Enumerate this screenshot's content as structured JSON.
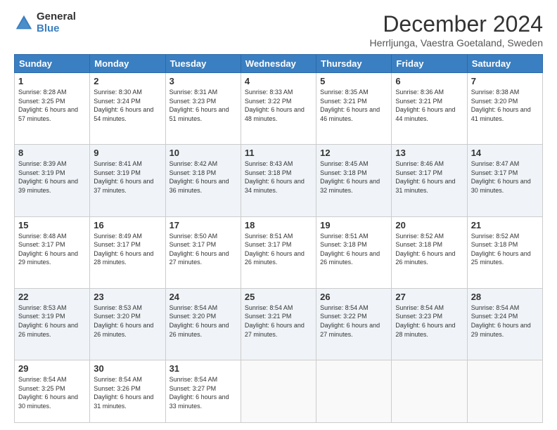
{
  "logo": {
    "general": "General",
    "blue": "Blue"
  },
  "header": {
    "month": "December 2024",
    "location": "Herrljunga, Vaestra Goetaland, Sweden"
  },
  "days_of_week": [
    "Sunday",
    "Monday",
    "Tuesday",
    "Wednesday",
    "Thursday",
    "Friday",
    "Saturday"
  ],
  "weeks": [
    [
      {
        "day": "1",
        "sunrise": "8:28 AM",
        "sunset": "3:25 PM",
        "daylight": "6 hours and 57 minutes."
      },
      {
        "day": "2",
        "sunrise": "8:30 AM",
        "sunset": "3:24 PM",
        "daylight": "6 hours and 54 minutes."
      },
      {
        "day": "3",
        "sunrise": "8:31 AM",
        "sunset": "3:23 PM",
        "daylight": "6 hours and 51 minutes."
      },
      {
        "day": "4",
        "sunrise": "8:33 AM",
        "sunset": "3:22 PM",
        "daylight": "6 hours and 48 minutes."
      },
      {
        "day": "5",
        "sunrise": "8:35 AM",
        "sunset": "3:21 PM",
        "daylight": "6 hours and 46 minutes."
      },
      {
        "day": "6",
        "sunrise": "8:36 AM",
        "sunset": "3:21 PM",
        "daylight": "6 hours and 44 minutes."
      },
      {
        "day": "7",
        "sunrise": "8:38 AM",
        "sunset": "3:20 PM",
        "daylight": "6 hours and 41 minutes."
      }
    ],
    [
      {
        "day": "8",
        "sunrise": "8:39 AM",
        "sunset": "3:19 PM",
        "daylight": "6 hours and 39 minutes."
      },
      {
        "day": "9",
        "sunrise": "8:41 AM",
        "sunset": "3:19 PM",
        "daylight": "6 hours and 37 minutes."
      },
      {
        "day": "10",
        "sunrise": "8:42 AM",
        "sunset": "3:18 PM",
        "daylight": "6 hours and 36 minutes."
      },
      {
        "day": "11",
        "sunrise": "8:43 AM",
        "sunset": "3:18 PM",
        "daylight": "6 hours and 34 minutes."
      },
      {
        "day": "12",
        "sunrise": "8:45 AM",
        "sunset": "3:18 PM",
        "daylight": "6 hours and 32 minutes."
      },
      {
        "day": "13",
        "sunrise": "8:46 AM",
        "sunset": "3:17 PM",
        "daylight": "6 hours and 31 minutes."
      },
      {
        "day": "14",
        "sunrise": "8:47 AM",
        "sunset": "3:17 PM",
        "daylight": "6 hours and 30 minutes."
      }
    ],
    [
      {
        "day": "15",
        "sunrise": "8:48 AM",
        "sunset": "3:17 PM",
        "daylight": "6 hours and 29 minutes."
      },
      {
        "day": "16",
        "sunrise": "8:49 AM",
        "sunset": "3:17 PM",
        "daylight": "6 hours and 28 minutes."
      },
      {
        "day": "17",
        "sunrise": "8:50 AM",
        "sunset": "3:17 PM",
        "daylight": "6 hours and 27 minutes."
      },
      {
        "day": "18",
        "sunrise": "8:51 AM",
        "sunset": "3:17 PM",
        "daylight": "6 hours and 26 minutes."
      },
      {
        "day": "19",
        "sunrise": "8:51 AM",
        "sunset": "3:18 PM",
        "daylight": "6 hours and 26 minutes."
      },
      {
        "day": "20",
        "sunrise": "8:52 AM",
        "sunset": "3:18 PM",
        "daylight": "6 hours and 26 minutes."
      },
      {
        "day": "21",
        "sunrise": "8:52 AM",
        "sunset": "3:18 PM",
        "daylight": "6 hours and 25 minutes."
      }
    ],
    [
      {
        "day": "22",
        "sunrise": "8:53 AM",
        "sunset": "3:19 PM",
        "daylight": "6 hours and 26 minutes."
      },
      {
        "day": "23",
        "sunrise": "8:53 AM",
        "sunset": "3:20 PM",
        "daylight": "6 hours and 26 minutes."
      },
      {
        "day": "24",
        "sunrise": "8:54 AM",
        "sunset": "3:20 PM",
        "daylight": "6 hours and 26 minutes."
      },
      {
        "day": "25",
        "sunrise": "8:54 AM",
        "sunset": "3:21 PM",
        "daylight": "6 hours and 27 minutes."
      },
      {
        "day": "26",
        "sunrise": "8:54 AM",
        "sunset": "3:22 PM",
        "daylight": "6 hours and 27 minutes."
      },
      {
        "day": "27",
        "sunrise": "8:54 AM",
        "sunset": "3:23 PM",
        "daylight": "6 hours and 28 minutes."
      },
      {
        "day": "28",
        "sunrise": "8:54 AM",
        "sunset": "3:24 PM",
        "daylight": "6 hours and 29 minutes."
      }
    ],
    [
      {
        "day": "29",
        "sunrise": "8:54 AM",
        "sunset": "3:25 PM",
        "daylight": "6 hours and 30 minutes."
      },
      {
        "day": "30",
        "sunrise": "8:54 AM",
        "sunset": "3:26 PM",
        "daylight": "6 hours and 31 minutes."
      },
      {
        "day": "31",
        "sunrise": "8:54 AM",
        "sunset": "3:27 PM",
        "daylight": "6 hours and 33 minutes."
      },
      null,
      null,
      null,
      null
    ]
  ]
}
